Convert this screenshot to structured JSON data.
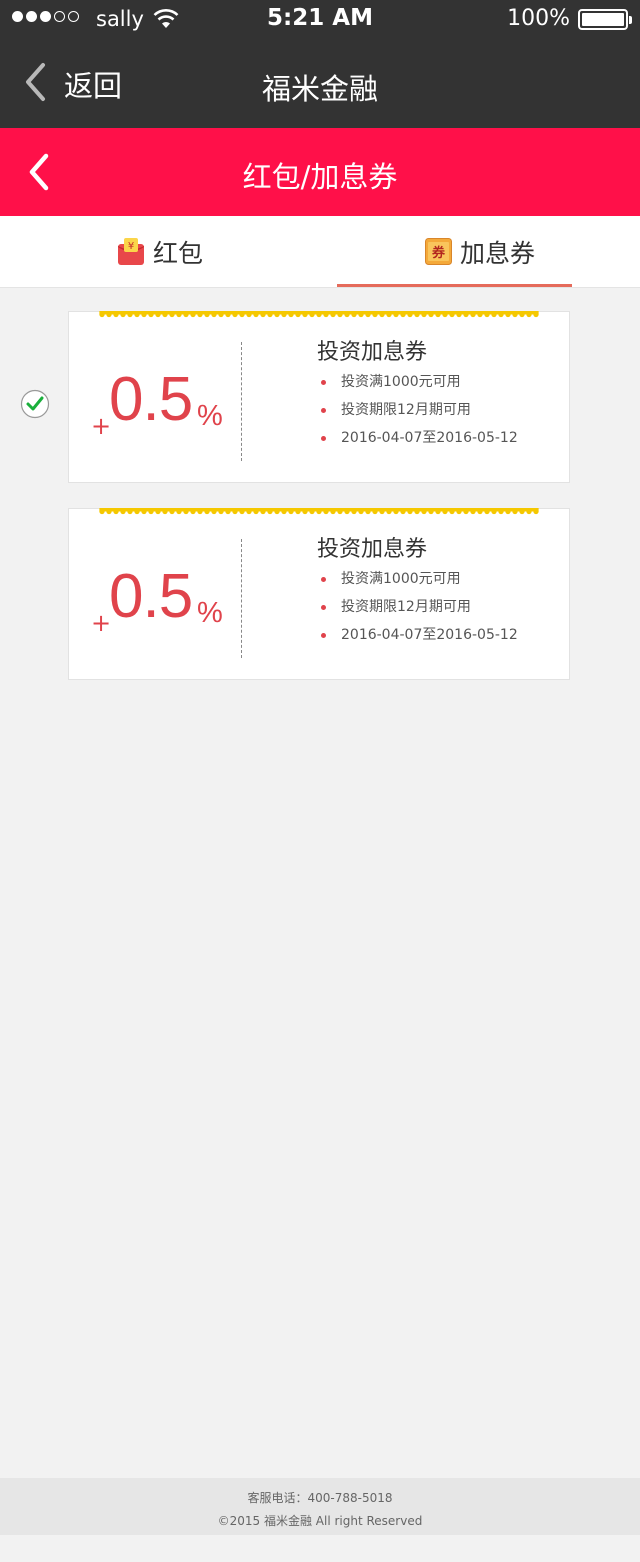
{
  "status_bar": {
    "carrier": "sally",
    "time": "5:21 AM",
    "battery": "100%",
    "signal_bars_filled": 3,
    "signal_bars_total": 5
  },
  "nav": {
    "back_label": "返回",
    "title": "福米金融"
  },
  "page": {
    "title": "红包/加息券"
  },
  "tabs": [
    {
      "label": "红包",
      "icon": "red-packet-icon",
      "active": false
    },
    {
      "label": "加息券",
      "icon": "coupon-icon",
      "active": true
    }
  ],
  "coupons": [
    {
      "plus": "+",
      "rate": "0.5",
      "unit": "%",
      "title": "投资加息券",
      "conditions": [
        "投资满1000元可用",
        "投资期限12月期可用",
        "2016-04-07至2016-05-12"
      ],
      "selected": true
    },
    {
      "plus": "+",
      "rate": "0.5",
      "unit": "%",
      "title": "投资加息券",
      "conditions": [
        "投资满1000元可用",
        "投资期限12月期可用",
        "2016-04-07至2016-05-12"
      ],
      "selected": false
    }
  ],
  "footer": {
    "phone": "客服电话：400-788-5018",
    "copyright": "©2015  福米金融  All right Reserved"
  },
  "colors": {
    "status_bg": "#333333",
    "header_red": "#ff1049",
    "accent_red": "#e0434b",
    "tab_underline": "#e56b5b",
    "coupon_band": "#f5c800",
    "check_green": "#1aaf3c"
  }
}
